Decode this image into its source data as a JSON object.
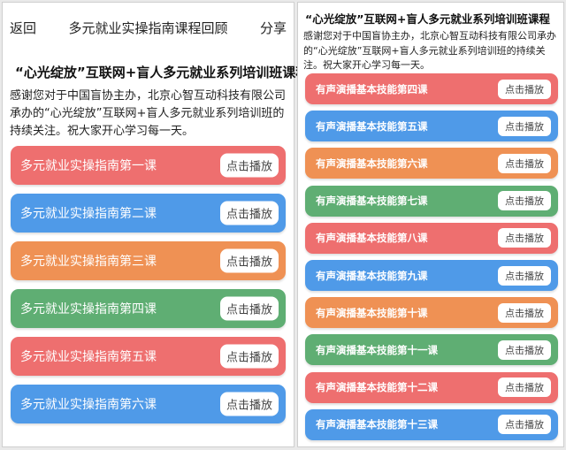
{
  "left": {
    "nav": {
      "back": "返回",
      "title": "多元就业实操指南课程回顾",
      "share": "分享"
    },
    "heading": "“心光绽放”互联网+盲人多元就业系列培训班课程",
    "intro": "感谢您对于中国盲协主办，北京心智互动科技有限公司承办的“心光绽放”互联网+盲人多元就业系列培训班的持续关注。祝大家开心学习每一天。",
    "play_label": "点击播放",
    "courses": [
      {
        "title": "多元就业实操指南第一课",
        "color": "#ee6f6f"
      },
      {
        "title": "多元就业实操指南第二课",
        "color": "#4f9ae8"
      },
      {
        "title": "多元就业实操指南第三课",
        "color": "#ef9154"
      },
      {
        "title": "多元就业实操指南第四课",
        "color": "#5fae73"
      },
      {
        "title": "多元就业实操指南第五课",
        "color": "#ee6f6f"
      },
      {
        "title": "多元就业实操指南第六课",
        "color": "#4f9ae8"
      }
    ]
  },
  "right": {
    "heading": "“心光绽放”互联网+盲人多元就业系列培训班课程",
    "intro": "感谢您对于中国盲协主办，北京心智互动科技有限公司承办的“心光绽放”互联网+盲人多元就业系列培训班的持续关注。祝大家开心学习每一天。",
    "play_label": "点击播放",
    "courses": [
      {
        "title": "有声演播基本技能第四课",
        "color": "#ee6f6f"
      },
      {
        "title": "有声演播基本技能第五课",
        "color": "#4f9ae8"
      },
      {
        "title": "有声演播基本技能第六课",
        "color": "#ef9154"
      },
      {
        "title": "有声演播基本技能第七课",
        "color": "#5fae73"
      },
      {
        "title": "有声演播基本技能第八课",
        "color": "#ee6f6f"
      },
      {
        "title": "有声演播基本技能第九课",
        "color": "#4f9ae8"
      },
      {
        "title": "有声演播基本技能第十课",
        "color": "#ef9154"
      },
      {
        "title": "有声演播基本技能第十一课",
        "color": "#5fae73"
      },
      {
        "title": "有声演播基本技能第十二课",
        "color": "#ee6f6f"
      },
      {
        "title": "有声演播基本技能第十三课",
        "color": "#4f9ae8"
      }
    ]
  }
}
